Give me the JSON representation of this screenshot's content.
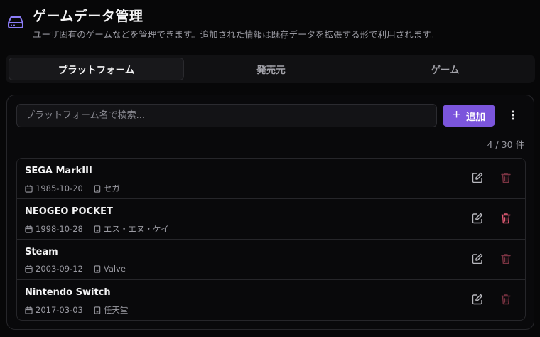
{
  "header": {
    "title": "ゲームデータ管理",
    "subtitle": "ユーザ固有のゲームなどを管理できます。追加された情報は既存データを拡張する形で利用されます。"
  },
  "tabs": [
    {
      "label": "プラットフォーム",
      "active": true
    },
    {
      "label": "発売元",
      "active": false
    },
    {
      "label": "ゲーム",
      "active": false
    }
  ],
  "toolbar": {
    "search_placeholder": "プラットフォーム名で検索...",
    "add_label": "追加"
  },
  "count": "4 / 30 件",
  "items": [
    {
      "name": "SEGA MarkIII",
      "date": "1985-10-20",
      "maker": "セガ",
      "delete_active": false
    },
    {
      "name": "NEOGEO POCKET",
      "date": "1998-10-28",
      "maker": "エス・エヌ・ケイ",
      "delete_active": true
    },
    {
      "name": "Steam",
      "date": "2003-09-12",
      "maker": "Valve",
      "delete_active": false
    },
    {
      "name": "Nintendo Switch",
      "date": "2017-03-03",
      "maker": "任天堂",
      "delete_active": false
    }
  ],
  "colors": {
    "accent": "#7b55dc",
    "header_icon": "#8b7cf6",
    "delete_active": "#e25a74",
    "delete_muted": "#7a3342"
  }
}
